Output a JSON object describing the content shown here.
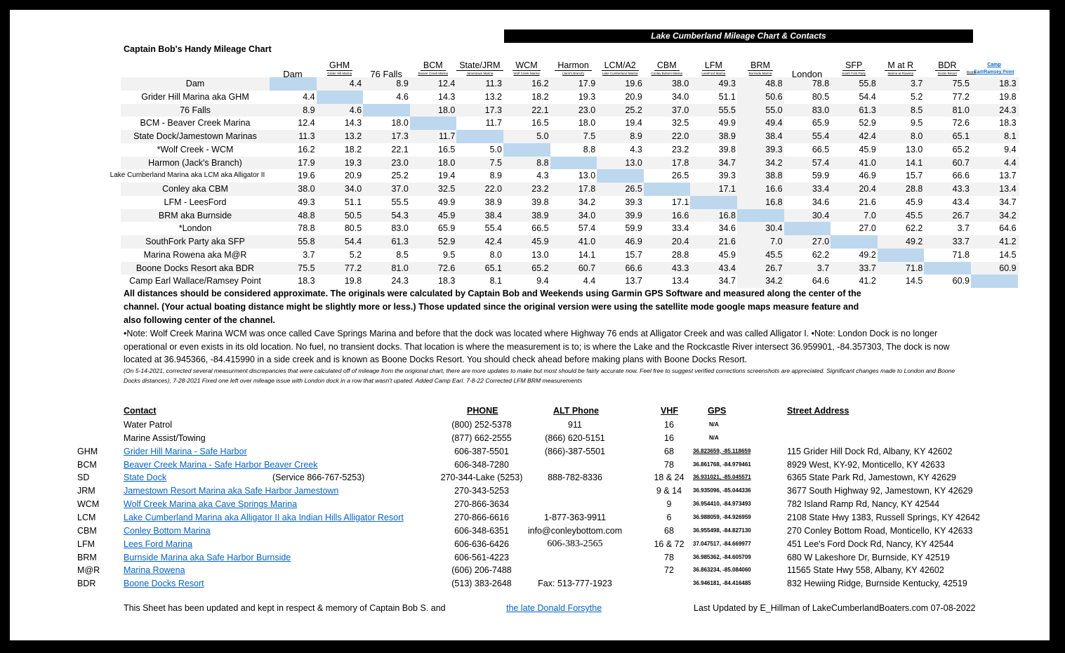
{
  "title_bar": "Lake Cumberland Mileage Chart & Contacts",
  "chart_title": "Captain Bob's Handy Mileage Chart",
  "columns": [
    {
      "main": "Dam",
      "sub": "",
      "big": true
    },
    {
      "main": "GHM",
      "sub": "Grider Hill Marina"
    },
    {
      "main": "76 Falls",
      "sub": "",
      "big": true
    },
    {
      "main": "BCM",
      "sub": "Beaver Creek Marina"
    },
    {
      "main": "State/JRM",
      "sub": "Jamestown Marina"
    },
    {
      "main": "WCM",
      "sub": "Wolf Creek Marina"
    },
    {
      "main": "Harmon",
      "sub": "(Jack's Branch)"
    },
    {
      "main": "LCM/A2",
      "sub": "Lake Cumberland Marina"
    },
    {
      "main": "CBM",
      "sub": "Conley Bottom Marina"
    },
    {
      "main": "LFM",
      "sub": "LeesFord Marina"
    },
    {
      "main": "BRM",
      "sub": "Burnside Marina"
    },
    {
      "main": "London",
      "sub": "",
      "big": true
    },
    {
      "main": "SFP",
      "sub": "South Fork Party"
    },
    {
      "main": "M at R",
      "sub": "Marina at Rowena"
    },
    {
      "main": "BDR",
      "sub": "Docks Resort"
    },
    {
      "main": "Camp",
      "sub": "Earl/Ramsey Point",
      "pre": "Boone"
    }
  ],
  "rows": [
    {
      "label": "Dam",
      "values": [
        null,
        "4.4",
        "8.9",
        "12.4",
        "11.3",
        "16.2",
        "17.9",
        "19.6",
        "38.0",
        "49.3",
        "48.8",
        "78.8",
        "55.8",
        "3.7",
        "75.5",
        "18.3"
      ]
    },
    {
      "label": "Grider Hill Marina aka GHM",
      "values": [
        "4.4",
        null,
        "4.6",
        "14.3",
        "13.2",
        "18.2",
        "19.3",
        "20.9",
        "34.0",
        "51.1",
        "50.6",
        "80.5",
        "54.4",
        "5.2",
        "77.2",
        "19.8"
      ]
    },
    {
      "label": "76 Falls",
      "values": [
        "8.9",
        "4.6",
        null,
        "18.0",
        "17.3",
        "22.1",
        "23.0",
        "25.2",
        "37.0",
        "55.5",
        "55.0",
        "83.0",
        "61.3",
        "8.5",
        "81.0",
        "24.3"
      ]
    },
    {
      "label": "BCM - Beaver Creek Marina",
      "values": [
        "12.4",
        "14.3",
        "18.0",
        null,
        "11.7",
        "16.5",
        "18.0",
        "19.4",
        "32.5",
        "49.9",
        "49.4",
        "65.9",
        "52.9",
        "9.5",
        "72.6",
        "18.3"
      ]
    },
    {
      "label": "State Dock/Jamestown Marinas",
      "values": [
        "11.3",
        "13.2",
        "17.3",
        "11.7",
        null,
        "5.0",
        "7.5",
        "8.9",
        "22.0",
        "38.9",
        "38.4",
        "55.4",
        "42.4",
        "8.0",
        "65.1",
        "8.1"
      ]
    },
    {
      "label": "*Wolf Creek - WCM",
      "values": [
        "16.2",
        "18.2",
        "22.1",
        "16.5",
        "5.0",
        null,
        "8.8",
        "4.3",
        "23.2",
        "39.8",
        "39.3",
        "66.5",
        "45.9",
        "13.0",
        "65.2",
        "9.4"
      ]
    },
    {
      "label": "Harmon (Jack's Branch)",
      "values": [
        "17.9",
        "19.3",
        "23.0",
        "18.0",
        "7.5",
        "8.8",
        null,
        "13.0",
        "17.8",
        "34.7",
        "34.2",
        "57.4",
        "41.0",
        "14.1",
        "60.7",
        "4.4"
      ]
    },
    {
      "label": "Lake Cumberland Marina aka LCM aka Alligator II",
      "small": true,
      "values": [
        "19.6",
        "20.9",
        "25.2",
        "19.4",
        "8.9",
        "4.3",
        "13.0",
        null,
        "26.5",
        "39.3",
        "38.8",
        "59.9",
        "46.9",
        "15.7",
        "66.6",
        "13.7"
      ]
    },
    {
      "label": "Conley aka CBM",
      "values": [
        "38.0",
        "34.0",
        "37.0",
        "32.5",
        "22.0",
        "23.2",
        "17.8",
        "26.5",
        null,
        "17.1",
        "16.6",
        "33.4",
        "20.4",
        "28.8",
        "43.3",
        "13.4"
      ]
    },
    {
      "label": "LFM - LeesFord",
      "values": [
        "49.3",
        "51.1",
        "55.5",
        "49.9",
        "38.9",
        "39.8",
        "34.2",
        "39.3",
        "17.1",
        null,
        "16.8",
        "34.6",
        "21.6",
        "45.9",
        "43.4",
        "34.7"
      ]
    },
    {
      "label": "BRM aka Burnside",
      "values": [
        "48.8",
        "50.5",
        "54.3",
        "45.9",
        "38.4",
        "38.9",
        "34.0",
        "39.9",
        "16.6",
        "16.8",
        null,
        "30.4",
        "7.0",
        "45.5",
        "26.7",
        "34.2"
      ]
    },
    {
      "label": "*London",
      "values": [
        "78.8",
        "80.5",
        "83.0",
        "65.9",
        "55.4",
        "66.5",
        "57.4",
        "59.9",
        "33.4",
        "34.6",
        "30.4",
        null,
        "27.0",
        "62.2",
        "3.7",
        "64.6"
      ]
    },
    {
      "label": "SouthFork Party aka SFP",
      "values": [
        "55.8",
        "54.4",
        "61.3",
        "52.9",
        "42.4",
        "45.9",
        "41.0",
        "46.9",
        "20.4",
        "21.6",
        "7.0",
        "27.0",
        null,
        "49.2",
        "33.7",
        "41.2"
      ]
    },
    {
      "label": "Marina Rowena aka M@R",
      "values": [
        "3.7",
        "5.2",
        "8.5",
        "9.5",
        "8.0",
        "13.0",
        "14.1",
        "15.7",
        "28.8",
        "45.9",
        "45.5",
        "62.2",
        "49.2",
        null,
        "71.8",
        "14.5"
      ]
    },
    {
      "label": "Boone Docks Resort aka BDR",
      "values": [
        "75.5",
        "77.2",
        "81.0",
        "72.6",
        "65.1",
        "65.2",
        "60.7",
        "66.6",
        "43.3",
        "43.4",
        "26.7",
        "3.7",
        "33.7",
        "71.8",
        null,
        "60.9"
      ]
    },
    {
      "label": "Camp Earl Wallace/Ramsey Point",
      "values": [
        "18.3",
        "19.8",
        "24.3",
        "18.3",
        "8.1",
        "9.4",
        "4.4",
        "13.7",
        "13.4",
        "34.7",
        "34.2",
        "64.6",
        "41.2",
        "14.5",
        "60.9",
        null
      ]
    }
  ],
  "notes": {
    "main": "All distances should be considered approximate. The originals were calculated by Captain Bob and Weekends using Garmin GPS Software and measured along the center of the channel. (Your actual boating distance might be slightly more or less.)  Those updated since the original version were using the satellite mode google maps measure feature and also following center of the channel.",
    "note": "•Note:   Wolf Creek Marina WCM was once called Cave Springs Marina and before that the dock was located where Highway 76 ends at Alligator Creek and was called Alligator I.                                   •Note: London Dock is no longer operational or even exists in its old location. No fuel, no transient docks.  That location is where the measurement is to;  is where the Lake and the Rockcastle River intersect 36.959901, -84.357303, The dock is now located at 36.945366, -84.415990 in a side creek and is known as Boone Docks Resort.  You should check ahead before making plans with Boone Docks Resort.",
    "changes": "(On 5-14-2021, corrected several measurment discrepancies that were calculated off of mileage from the origional chart, there are more updates to make but most should be fairly accurate now.  Feel free to suggest verified corrections screenshots are appreciated.  Significant changes made to London and Boone Docks distances), 7-28-2021 Fixed one left over mileage issue with London dock in a row that wasn't upated.  Added Camp Earl. 7-8-22 Corrected LFM BRM measurements"
  },
  "contacts_header": {
    "contact": "Contact",
    "phone": "PHONE",
    "alt_phone": "ALT Phone",
    "vhf": "VHF",
    "gps": "GPS",
    "address": "Street Address"
  },
  "contacts": [
    {
      "code": "",
      "name": "Water Patrol",
      "link": false,
      "phone": "(800) 252-5378",
      "alt": "911",
      "vhf": "16",
      "gps": "N/A",
      "address": ""
    },
    {
      "code": "",
      "name": "Marine Assist/Towing",
      "link": false,
      "phone": "(877) 662-2555",
      "alt": "(866) 620-5151",
      "vhf": "16",
      "gps": "N/A",
      "address": ""
    },
    {
      "code": "GHM",
      "name": "Grider Hill Marina - Safe Harbor",
      "link": true,
      "phone": "606-387-5501",
      "alt": "(866)-387-5501",
      "vhf": "68",
      "gps": "36.823659, -85.118659",
      "gps_link": true,
      "address": "115 Grider Hill Dock Rd, Albany, KY 42602"
    },
    {
      "code": "BCM",
      "name": "Beaver Creek Marina - Safe Harbor Beaver Creek",
      "link": true,
      "phone": "606-348-7280",
      "alt": "",
      "vhf": "78",
      "gps": "36.861768, -84.979461",
      "address": "8929 West, KY-92, Monticello, KY 42633"
    },
    {
      "code": "SD",
      "name": "State Dock ",
      "link": true,
      "note": "(Service 866-767-5253)",
      "phone": "270-344-Lake (5253)",
      "alt": "888-782-8336",
      "vhf": "18 & 24",
      "gps": "36.931021, -85.045571",
      "gps_link": true,
      "address": "6365 State Park Rd, Jamestown, KY 42629"
    },
    {
      "code": "JRM",
      "name": "Jamestown Resort Marina aka Safe Harbor Jamestown",
      "link": true,
      "phone": "270-343-5253",
      "alt": "",
      "vhf": "9 & 14",
      "gps": "36.935096, -85.044336",
      "address": "3677 South Highway 92, Jamestown, KY 42629"
    },
    {
      "code": "WCM",
      "name": "Wolf Creek Marina  aka Cave Springs Marina",
      "link": true,
      "phone": "270-866-3634",
      "alt": "",
      "vhf": "9",
      "gps": "36.954410, -84.973493",
      "address": "782 Island Ramp Rd, Nancy, KY 42544"
    },
    {
      "code": "LCM",
      "name": "Lake Cumberland Marina aka Alligator II aka Indian Hills Alligator Resort",
      "link": true,
      "phone": "270-866-6616",
      "alt": "1-877-363-9911",
      "vhf": "6",
      "gps": "36.988059, -84.926959",
      "address": "2108 State Hwy 1383, Russell Springs, KY 42642"
    },
    {
      "code": "CBM",
      "name": "Conley Bottom Marina ",
      "link": true,
      "phone": "606-348-6351",
      "alt": "info@conleybottom.com",
      "vhf": "68",
      "gps": "36.955498, -84.827130",
      "address": "270 Conley Bottom Road, Monticello, KY 42633"
    },
    {
      "code": "LFM",
      "name": "Lees Ford Marina",
      "link": true,
      "phone": "606-636-6426",
      "alt": "606-383-2565",
      "alt_style": "serif",
      "vhf": "16 & 72",
      "gps": "37.047517, -84.669977",
      "address": "451 Lee's Ford Dock Rd, Nancy, KY 42544"
    },
    {
      "code": "BRM",
      "name": "Burnside Marina aka Safe Harbor Burnside",
      "link": true,
      "phone": "606-561-4223",
      "alt": "",
      "vhf": "78",
      "gps": "36.985362, -84.605709",
      "address": "680 W Lakeshore Dr, Burnside, KY 42519"
    },
    {
      "code": "M@R",
      "name": "Marina Rowena",
      "link": true,
      "phone": "(606) 206-7488",
      "alt": "",
      "vhf": "72",
      "gps": "36.863234, -85.084060",
      "address": "11565 State Hwy 558, Albany, KY 42602"
    },
    {
      "code": "BDR",
      "name": "Boone Docks Resort",
      "link": true,
      "phone": "(513) 383-2648",
      "alt": "Fax: 513-777-1923",
      "alt_style": "arial",
      "vhf": "",
      "gps": "36.946181, -84.416485",
      "address": "832 Hewiing Ridge, Burnside Kentucky,  42519"
    }
  ],
  "footer": {
    "memory": "This Sheet has been updated and kept in respect & memory of Captain Bob S.   and",
    "link": "the late Donald Forsythe",
    "updated": "Last Updated by E_Hillman of LakeCumberlandBoaters.com 07-08-2022"
  },
  "colors": {
    "diagonal": "#bdd7ee",
    "alt_row": "#f2f2f2",
    "link": "#0563c1",
    "title_bar": "#000000"
  }
}
